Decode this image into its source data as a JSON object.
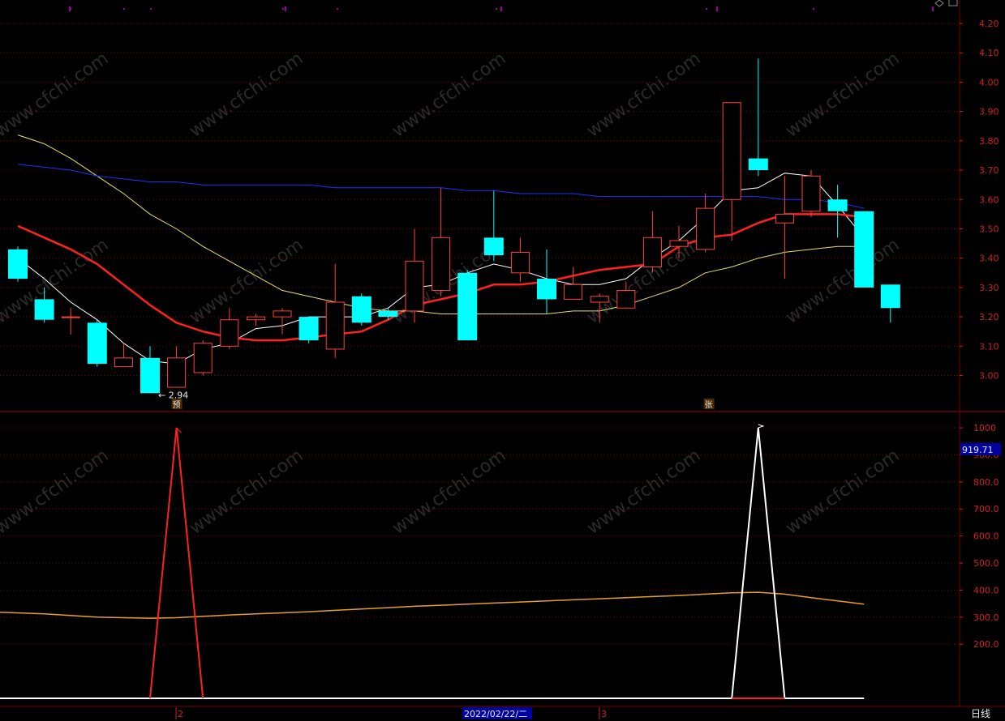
{
  "colors": {
    "background": "#000000",
    "grid": "#7a0000",
    "axis_text": "#d02020",
    "up_candle": "#ff4040",
    "down_candle": "#00ffff",
    "ma_white": "#ffffff",
    "ma_red": "#ff2020",
    "ma_yellow": "#e8e060",
    "ma_blue": "#2030ff",
    "current_value_box": "#0000a0",
    "date_box": "#0000a0"
  },
  "watermark": "www.cfchi.com",
  "top_icons": [
    "diamond-icon",
    "lock-icon"
  ],
  "chart_data": [
    {
      "type": "candlestick",
      "panel": "price",
      "y_ticks": [
        "4.20",
        "4.10",
        "4.00",
        "3.90",
        "3.80",
        "3.70",
        "3.60",
        "3.50",
        "3.40",
        "3.30",
        "3.20",
        "3.10",
        "3.00"
      ],
      "y_tick_values": [
        4.2,
        4.1,
        4.0,
        3.9,
        3.8,
        3.7,
        3.6,
        3.5,
        3.4,
        3.3,
        3.2,
        3.1,
        3.0
      ],
      "ylim": [
        2.88,
        4.28
      ],
      "low_marker": "2.94",
      "markers": [
        {
          "index": 6,
          "text": "预"
        },
        {
          "index": 26,
          "text": "张"
        }
      ],
      "candles": [
        {
          "o": 3.43,
          "h": 3.44,
          "l": 3.32,
          "c": 3.33
        },
        {
          "o": 3.26,
          "h": 3.3,
          "l": 3.18,
          "c": 3.19
        },
        {
          "o": 3.2,
          "h": 3.23,
          "l": 3.14,
          "c": 3.2
        },
        {
          "o": 3.18,
          "h": 3.19,
          "l": 3.03,
          "c": 3.04
        },
        {
          "o": 3.03,
          "h": 3.11,
          "l": 3.03,
          "c": 3.06
        },
        {
          "o": 3.06,
          "h": 3.1,
          "l": 2.94,
          "c": 2.94
        },
        {
          "o": 2.96,
          "h": 3.1,
          "l": 2.96,
          "c": 3.06
        },
        {
          "o": 3.01,
          "h": 3.12,
          "l": 3.0,
          "c": 3.11
        },
        {
          "o": 3.1,
          "h": 3.23,
          "l": 3.09,
          "c": 3.19
        },
        {
          "o": 3.19,
          "h": 3.21,
          "l": 3.17,
          "c": 3.2
        },
        {
          "o": 3.2,
          "h": 3.23,
          "l": 3.14,
          "c": 3.22
        },
        {
          "o": 3.2,
          "h": 3.2,
          "l": 3.11,
          "c": 3.12
        },
        {
          "o": 3.09,
          "h": 3.38,
          "l": 3.06,
          "c": 3.25
        },
        {
          "o": 3.27,
          "h": 3.28,
          "l": 3.17,
          "c": 3.18
        },
        {
          "o": 3.22,
          "h": 3.23,
          "l": 3.19,
          "c": 3.2
        },
        {
          "o": 3.22,
          "h": 3.5,
          "l": 3.18,
          "c": 3.39
        },
        {
          "o": 3.29,
          "h": 3.64,
          "l": 3.27,
          "c": 3.47
        },
        {
          "o": 3.35,
          "h": 3.36,
          "l": 3.12,
          "c": 3.12
        },
        {
          "o": 3.47,
          "h": 3.63,
          "l": 3.39,
          "c": 3.41
        },
        {
          "o": 3.35,
          "h": 3.47,
          "l": 3.32,
          "c": 3.42
        },
        {
          "o": 3.33,
          "h": 3.43,
          "l": 3.21,
          "c": 3.26
        },
        {
          "o": 3.26,
          "h": 3.37,
          "l": 3.26,
          "c": 3.31
        },
        {
          "o": 3.25,
          "h": 3.28,
          "l": 3.18,
          "c": 3.27
        },
        {
          "o": 3.23,
          "h": 3.32,
          "l": 3.23,
          "c": 3.29
        },
        {
          "o": 3.37,
          "h": 3.56,
          "l": 3.35,
          "c": 3.47
        },
        {
          "o": 3.44,
          "h": 3.51,
          "l": 3.4,
          "c": 3.46
        },
        {
          "o": 3.43,
          "h": 3.62,
          "l": 3.42,
          "c": 3.57
        },
        {
          "o": 3.6,
          "h": 3.93,
          "l": 3.46,
          "c": 3.93
        },
        {
          "o": 3.74,
          "h": 4.08,
          "l": 3.68,
          "c": 3.7
        },
        {
          "o": 3.52,
          "h": 3.68,
          "l": 3.33,
          "c": 3.55
        },
        {
          "o": 3.56,
          "h": 3.7,
          "l": 3.54,
          "c": 3.68
        },
        {
          "o": 3.6,
          "h": 3.65,
          "l": 3.47,
          "c": 3.56
        },
        {
          "o": 3.56,
          "h": 3.56,
          "l": 3.3,
          "c": 3.3
        },
        {
          "o": 3.31,
          "h": 3.31,
          "l": 3.18,
          "c": 3.23
        }
      ],
      "series": [
        {
          "color": "#ffffff",
          "values": [
            3.4,
            3.33,
            3.25,
            3.19,
            3.11,
            3.05,
            3.04,
            3.09,
            3.11,
            3.16,
            3.17,
            3.2,
            3.2,
            3.2,
            3.23,
            3.3,
            3.31,
            3.35,
            3.38,
            3.36,
            3.33,
            3.31,
            3.31,
            3.33,
            3.4,
            3.46,
            3.54,
            3.63,
            3.64,
            3.69,
            3.68,
            3.58,
            3.47
          ]
        },
        {
          "color": "#ff2020",
          "values": [
            3.51,
            3.47,
            3.43,
            3.38,
            3.31,
            3.24,
            3.18,
            3.15,
            3.13,
            3.12,
            3.12,
            3.13,
            3.14,
            3.15,
            3.19,
            3.24,
            3.26,
            3.28,
            3.31,
            3.31,
            3.32,
            3.34,
            3.36,
            3.37,
            3.38,
            3.44,
            3.47,
            3.48,
            3.52,
            3.55,
            3.55,
            3.55,
            3.54
          ]
        },
        {
          "color": "#e8e060",
          "values": [
            3.82,
            3.79,
            3.74,
            3.68,
            3.62,
            3.55,
            3.5,
            3.44,
            3.39,
            3.34,
            3.29,
            3.27,
            3.25,
            3.23,
            3.22,
            3.22,
            3.21,
            3.21,
            3.21,
            3.21,
            3.21,
            3.22,
            3.22,
            3.24,
            3.27,
            3.3,
            3.35,
            3.37,
            3.4,
            3.42,
            3.43,
            3.44,
            3.44
          ]
        },
        {
          "color": "#2030ff",
          "values": [
            3.72,
            3.71,
            3.7,
            3.68,
            3.67,
            3.66,
            3.66,
            3.65,
            3.65,
            3.65,
            3.65,
            3.65,
            3.64,
            3.64,
            3.64,
            3.64,
            3.64,
            3.63,
            3.63,
            3.62,
            3.62,
            3.62,
            3.61,
            3.61,
            3.61,
            3.61,
            3.61,
            3.61,
            3.61,
            3.6,
            3.6,
            3.59,
            3.57
          ]
        }
      ]
    },
    {
      "type": "line",
      "panel": "indicator",
      "y_ticks": [
        "1000",
        "900.0",
        "800.0",
        "700.0",
        "600.0",
        "500.0",
        "400.0",
        "300.0",
        "200.0"
      ],
      "y_tick_values": [
        1000,
        900,
        800,
        700,
        600,
        500,
        400,
        300,
        200
      ],
      "ylim": [
        -30,
        1060
      ],
      "current_value": "919.71",
      "series": [
        {
          "color": "#ff2020",
          "values": [
            0,
            0,
            0,
            0,
            0,
            0,
            1000,
            0,
            0,
            0,
            0,
            0,
            0,
            0,
            0,
            0,
            0,
            0,
            0,
            0,
            0,
            0,
            0,
            0,
            0,
            0,
            0,
            0,
            0,
            0,
            0,
            0,
            0,
            0
          ]
        },
        {
          "color": "#ffffff",
          "values": [
            0,
            0,
            0,
            0,
            0,
            0,
            0,
            0,
            0,
            0,
            0,
            0,
            0,
            0,
            0,
            0,
            0,
            0,
            0,
            0,
            0,
            0,
            0,
            0,
            0,
            0,
            0,
            0,
            1000,
            0,
            0,
            0,
            0,
            0
          ]
        },
        {
          "color": "#e8a020",
          "values": [
            318,
            312,
            306,
            300,
            298,
            296,
            298,
            303,
            308,
            312,
            316,
            320,
            325,
            330,
            335,
            340,
            344,
            348,
            352,
            356,
            360,
            364,
            368,
            372,
            376,
            380,
            385,
            390,
            392,
            385,
            372,
            360,
            348,
            335
          ]
        }
      ]
    }
  ],
  "bottom_bar": {
    "date": "2022/02/22/二",
    "month_marks": [
      "2",
      "3"
    ],
    "timeframe": "日线"
  }
}
